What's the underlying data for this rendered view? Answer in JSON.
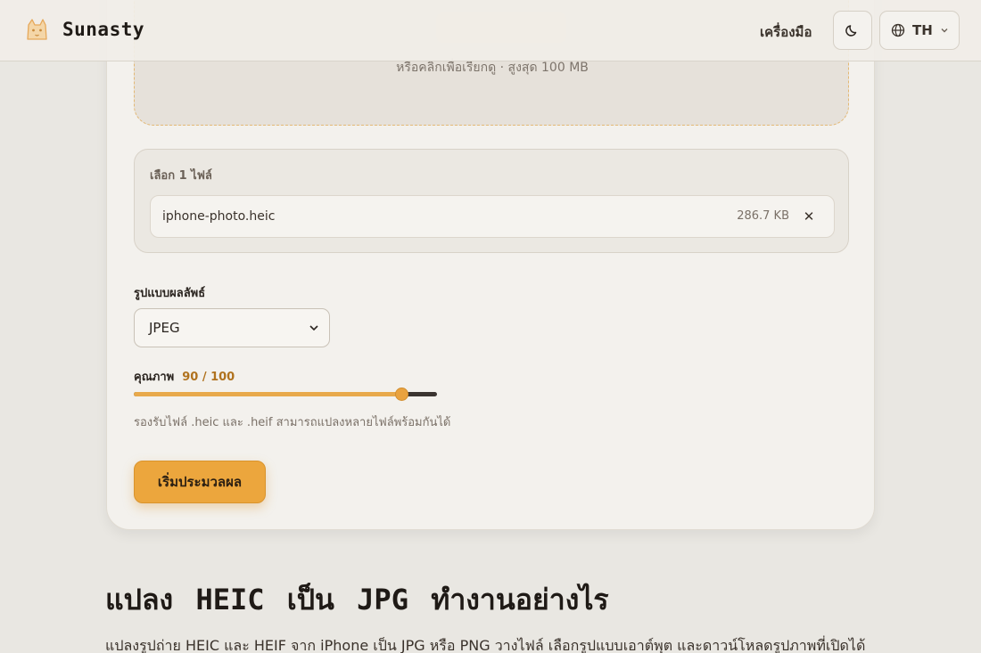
{
  "header": {
    "brand_name": "Sunasty",
    "nav_tools": "เครื่องมือ",
    "language_code": "TH"
  },
  "dropzone": {
    "hint": "หรือคลิกเพื่อเรียกดู · สูงสุด 100 MB"
  },
  "files": {
    "title": "เลือก 1 ไฟล์",
    "items": [
      {
        "name": "iphone-photo.heic",
        "size": "286.7 KB"
      }
    ],
    "remove_glyph": "✕"
  },
  "format": {
    "label": "รูปแบบผลลัพธ์",
    "selected": "JPEG"
  },
  "quality": {
    "label": "คุณภาพ",
    "value_text": "90 / 100",
    "value": 90,
    "max": 100
  },
  "help_text": "รองรับไฟล์ .heic และ .heif สามารถแปลงหลายไฟล์พร้อมกันได้",
  "start_button": "เริ่มประมวลผล",
  "article": {
    "title": "แปลง HEIC เป็น JPG ทำงานอย่างไร",
    "body": "แปลงรูปถ่าย HEIC และ HEIF จาก iPhone เป็น JPG หรือ PNG วางไฟล์ เลือกรูปแบบเอาต์พุต และดาวน์โหลดรูปภาพที่เปิดได้"
  },
  "colors": {
    "accent": "#eca63d",
    "quality_value": "#b0721e",
    "background": "#e9e7e2"
  }
}
